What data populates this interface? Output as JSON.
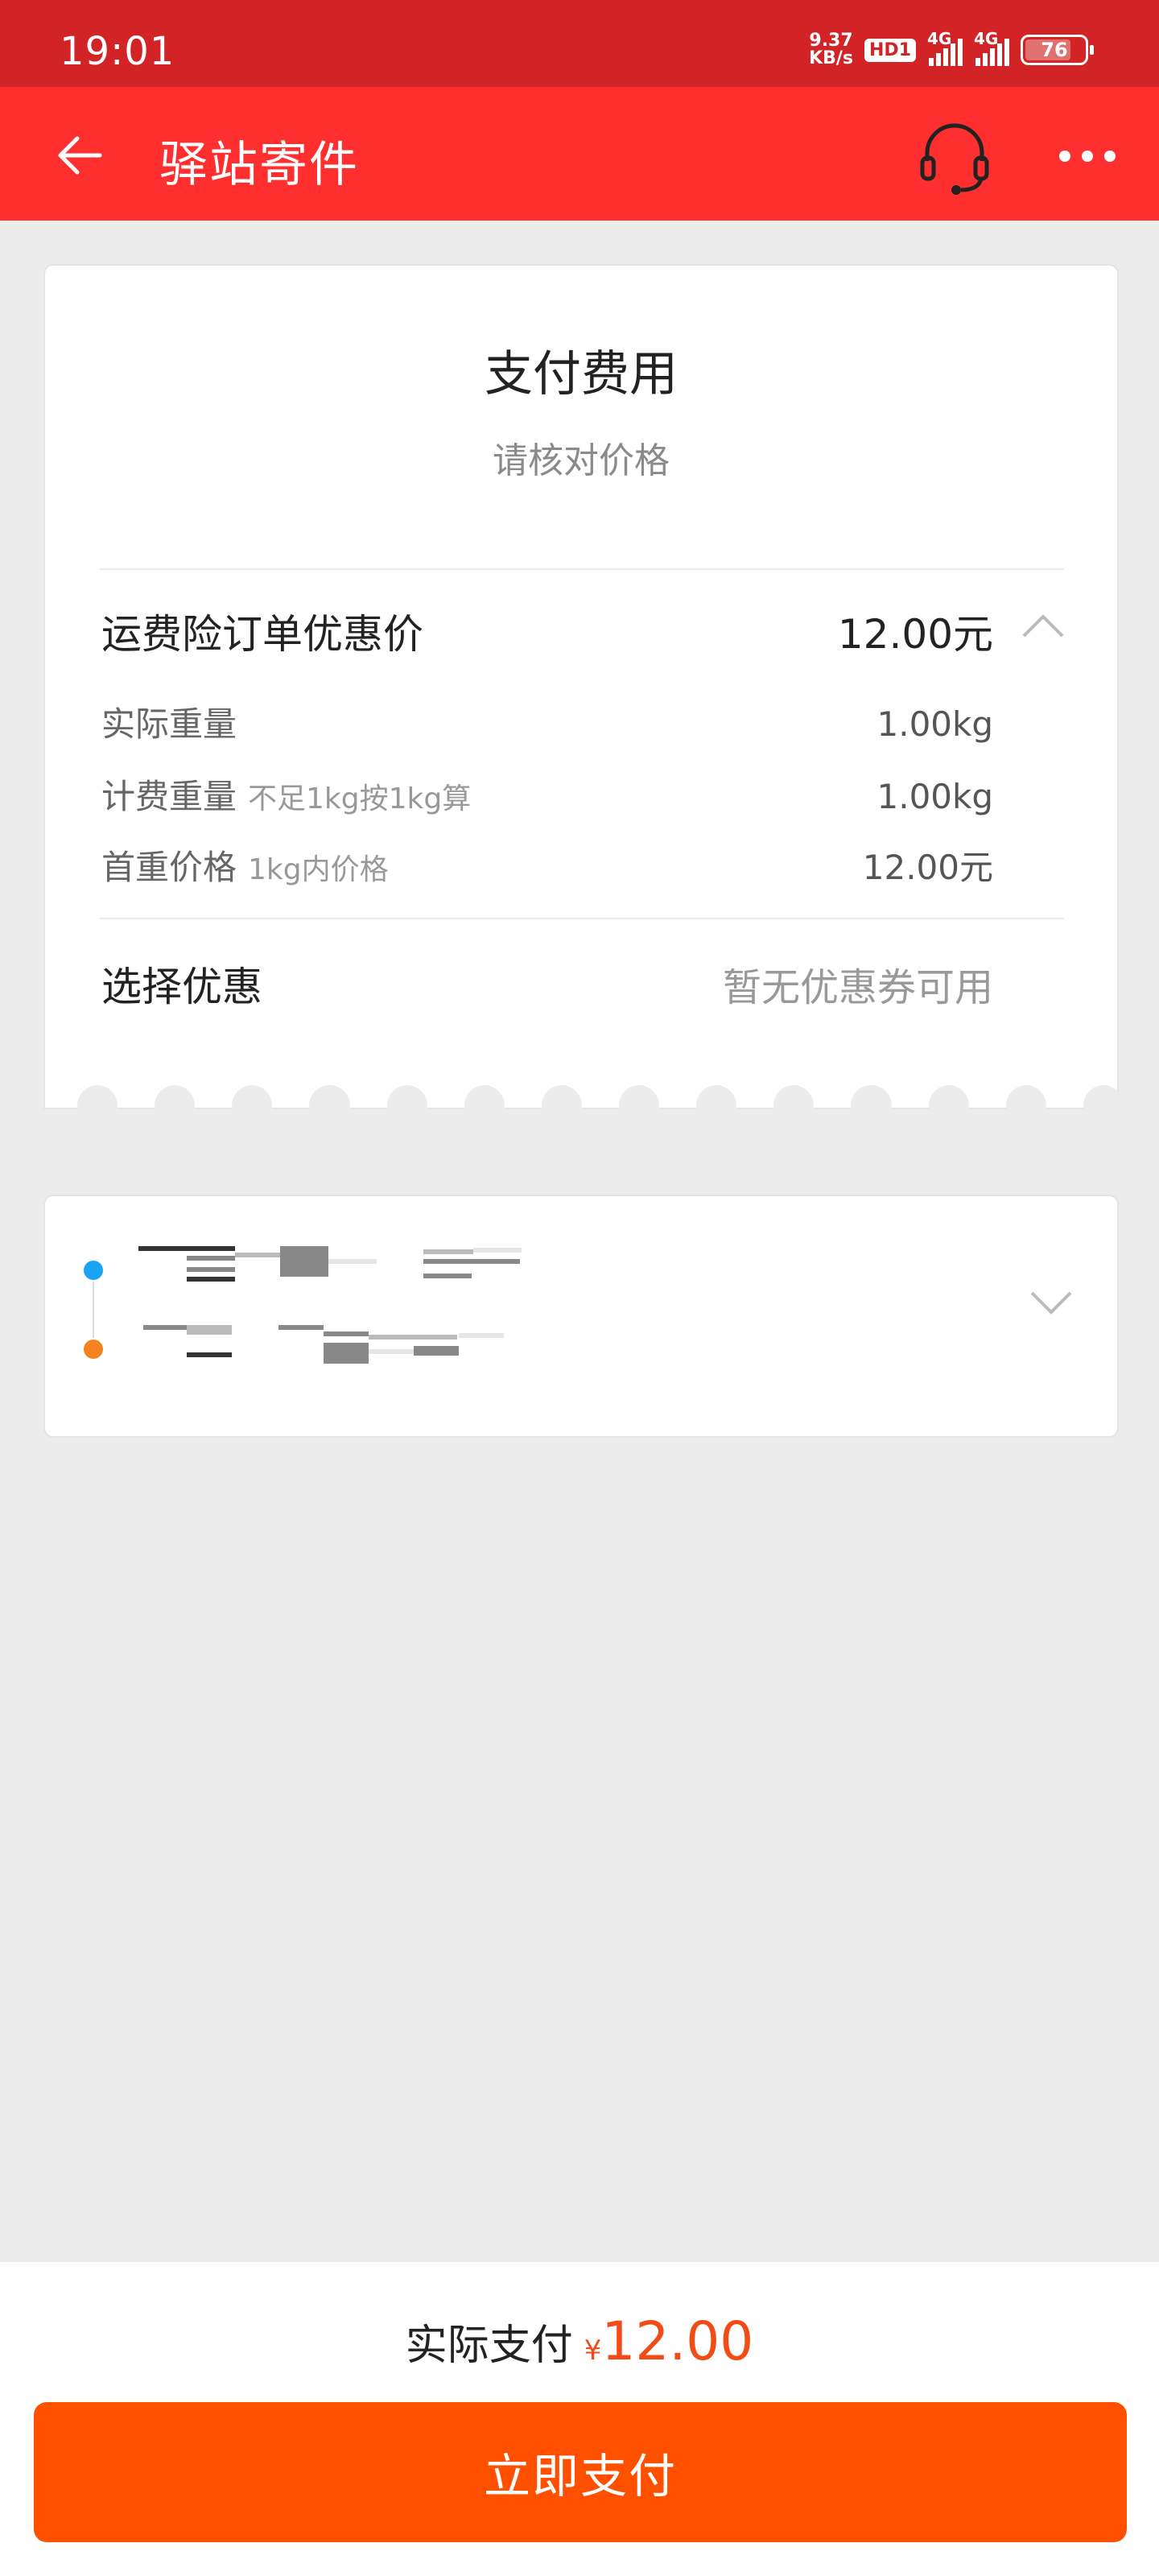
{
  "status_bar": {
    "time": "19:01",
    "net_speed_value": "9.37",
    "net_speed_unit": "KB/s",
    "hd_badge": "HD1",
    "sim1_label": "4G",
    "sim2_label": "4G",
    "battery": "76"
  },
  "navbar": {
    "title": "驿站寄件",
    "back_icon": "arrow-left-icon",
    "service_icon": "headset-icon",
    "more_icon": "more-dots-icon"
  },
  "fee_card": {
    "title": "支付费用",
    "subtitle": "请核对价格",
    "main_label": "运费险订单优惠价",
    "main_value": "12.00元",
    "collapse_icon": "chevron-up-icon",
    "details": [
      {
        "label": "实际重量",
        "hint": "",
        "value": "1.00kg"
      },
      {
        "label": "计费重量",
        "hint": "不足1kg按1kg算",
        "value": "1.00kg"
      },
      {
        "label": "首重价格",
        "hint": "1kg内价格",
        "value": "12.00元"
      }
    ],
    "coupon_label": "选择优惠",
    "coupon_value": "暂无优惠券可用"
  },
  "address_card": {
    "expand_icon": "chevron-down-icon",
    "sender_dot_color": "#1aa3f2",
    "receiver_dot_color": "#f5821f"
  },
  "bottom_bar": {
    "total_label": "实际支付",
    "currency": "¥",
    "total_amount": "12.00",
    "pay_button": "立即支付",
    "accent_color": "#ff5000"
  }
}
